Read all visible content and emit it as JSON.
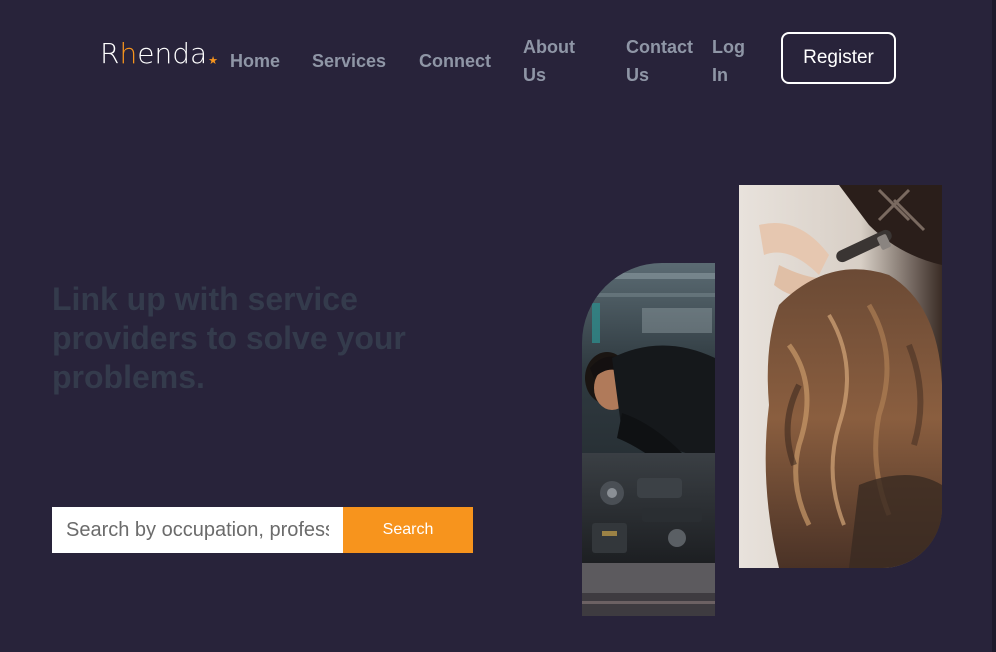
{
  "brand": {
    "logo_part1": "R",
    "logo_accent": "h",
    "logo_part2": "enda",
    "logo_star": "★",
    "accent_color": "#f7941d"
  },
  "nav": {
    "home": "Home",
    "services": "Services",
    "connect": "Connect",
    "about": "About Us",
    "contact": "Contact Us",
    "login": "Log In",
    "register": "Register"
  },
  "hero": {
    "title": "Link up with service providers to solve your problems."
  },
  "search": {
    "placeholder": "Search by occupation, profession",
    "button_label": "Search"
  },
  "images": {
    "mechanic": "mechanic-photo",
    "hairdresser": "hairdresser-photo"
  },
  "colors": {
    "background": "#28233a",
    "nav_text": "#8f96a6",
    "title_text": "#343b4c",
    "button_accent": "#f7941d"
  }
}
